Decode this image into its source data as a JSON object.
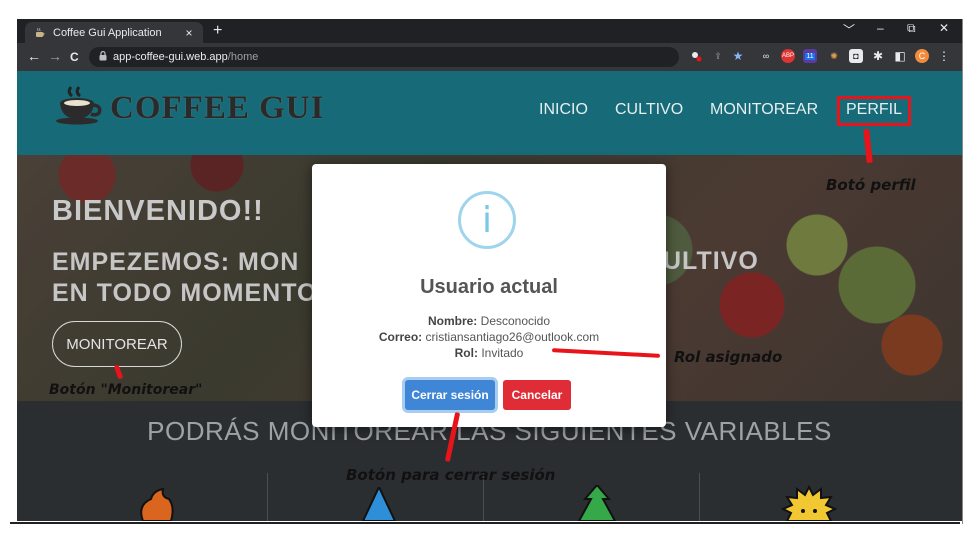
{
  "browser": {
    "tab_title": "Coffee Gui Application",
    "tab_close": "×",
    "new_tab": "+",
    "url_host": "app-coffee-gui.web.app",
    "url_path": "/home",
    "window_controls": [
      "﹀",
      "–",
      "⧉",
      "✕"
    ],
    "nav": {
      "back": "←",
      "forward": "→",
      "reload": "C"
    },
    "profile_initial": "C",
    "ext_badge": "11",
    "ext_abp": "ABP"
  },
  "site": {
    "logo_text": "COFFEE GUI",
    "nav": [
      "INICIO",
      "CULTIVO",
      "MONITOREAR",
      "PERFIL"
    ],
    "hero_title1": "BIENVENIDO!!",
    "hero_line1": "EMPEZEMOS: MON",
    "hero_line2": "EN TODO MOMENTO",
    "hero_line1_right": "ULTIVO",
    "monitor_button": "MONITOREAR",
    "section_title": "PODRÁS MONITOREAR LAS SIGUIENTES VARIABLES"
  },
  "modal": {
    "icon": "i",
    "title": "Usuario actual",
    "name_label": "Nombre:",
    "name_value": "Desconocido",
    "email_label": "Correo:",
    "email_value": "cristiansantiago26@outlook.com",
    "role_label": "Rol:",
    "role_value": "Invitado",
    "logout_button": "Cerrar sesión",
    "cancel_button": "Cancelar"
  },
  "annotations": {
    "profile": "Botó perfil",
    "role": "Rol asignado",
    "monitor": "Botón \"Monitorear\"",
    "logout": "Botón para cerrar sesión"
  },
  "colors": {
    "navbar": "#176b78",
    "annotation_red": "#e8141c",
    "primary_button": "#3f86d6",
    "danger_button": "#e02c36",
    "info_icon": "#9ed5ec"
  }
}
